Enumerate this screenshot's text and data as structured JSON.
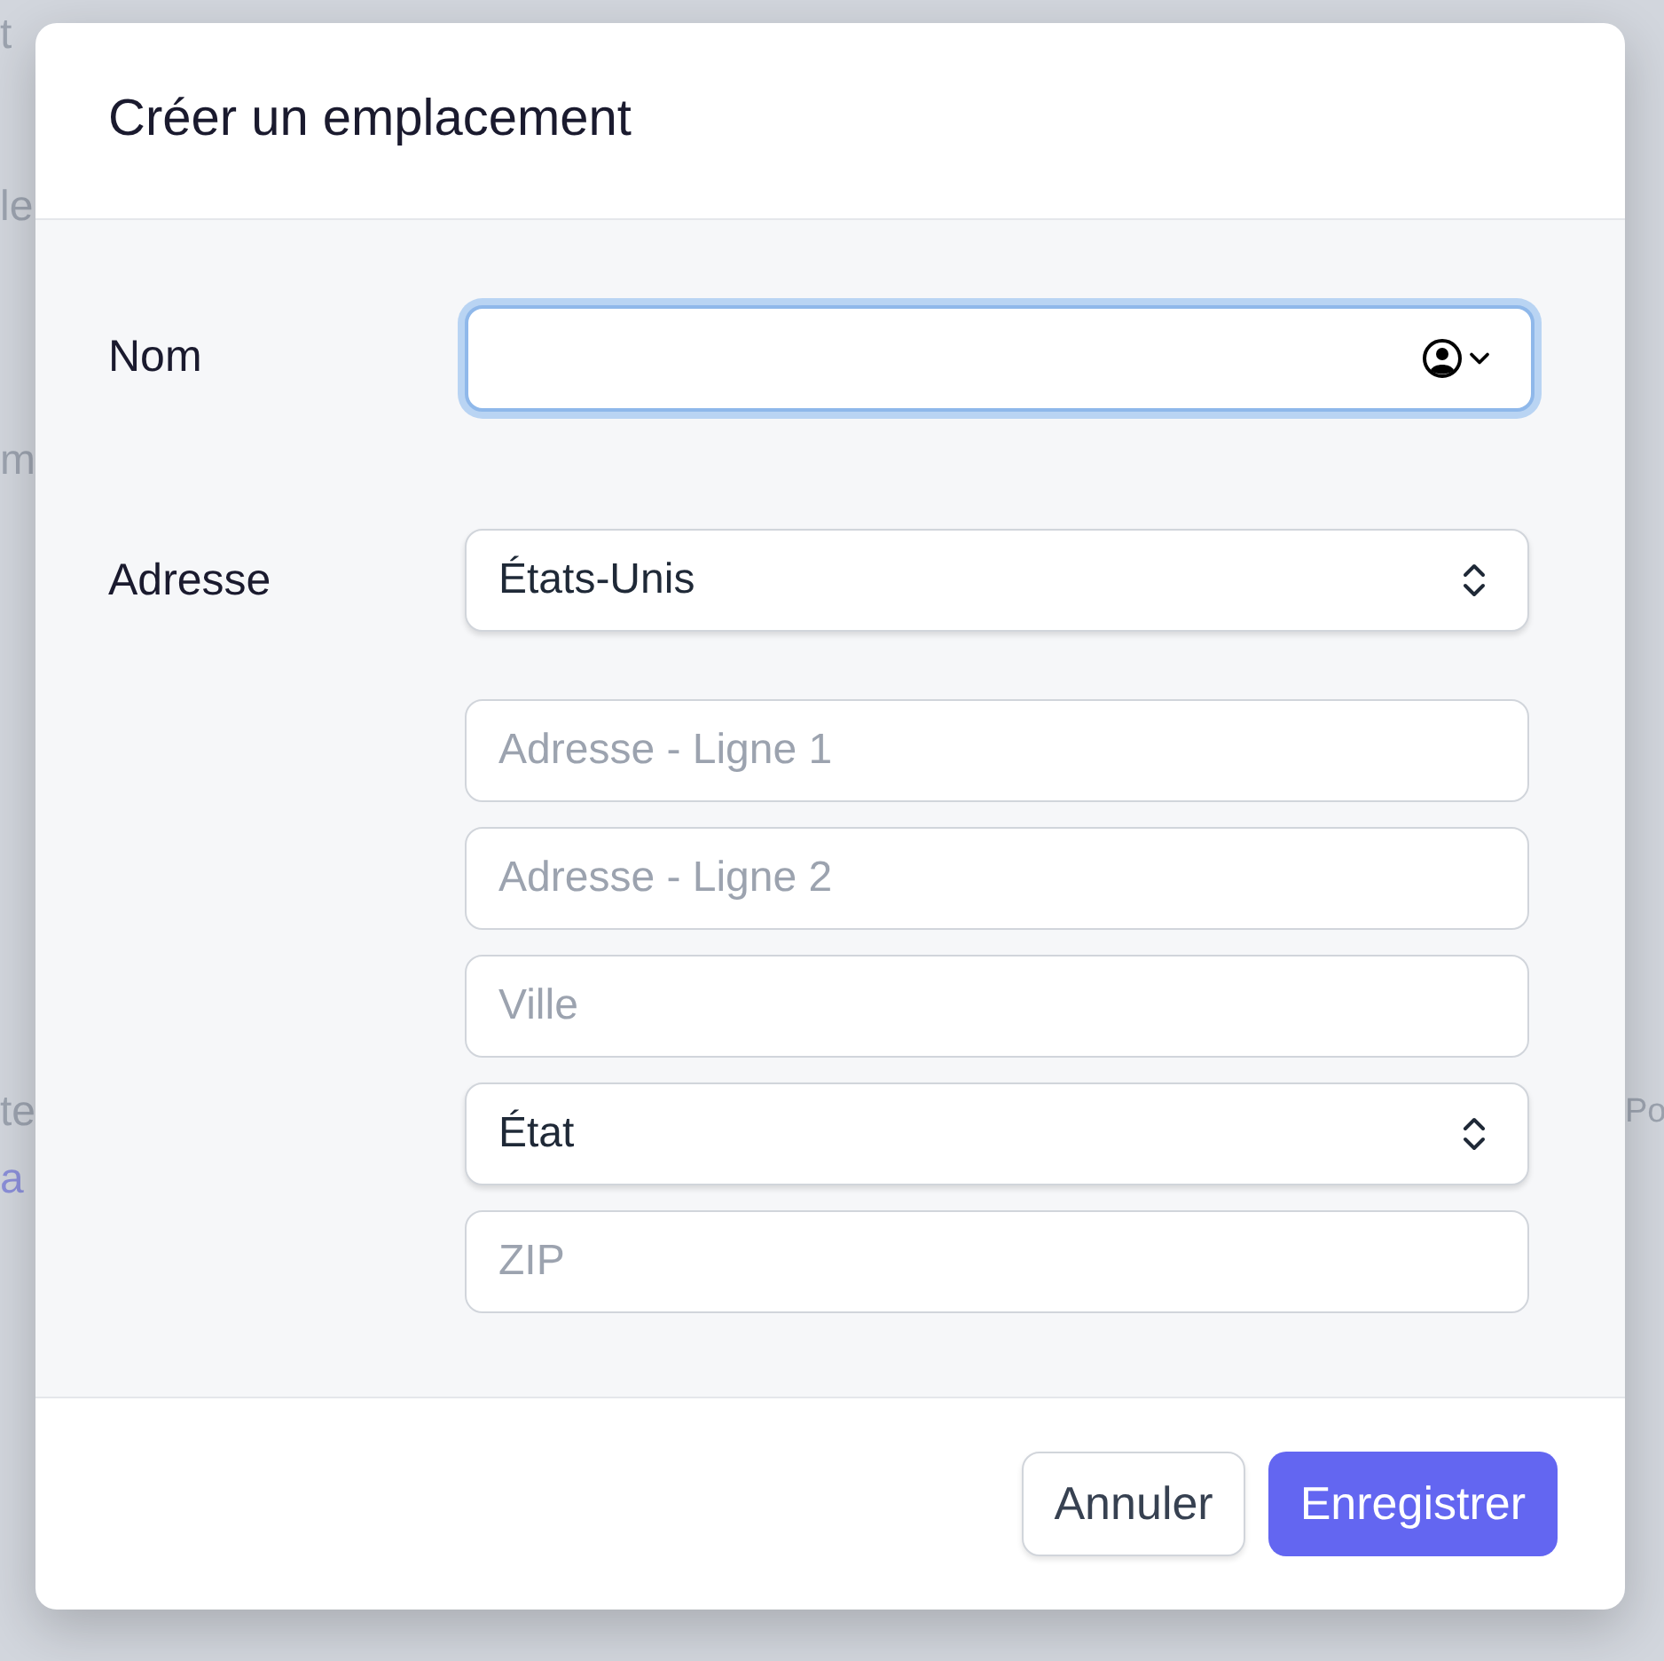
{
  "backdrop": {
    "left_fragments": [
      {
        "text": "t",
        "kind": "text"
      },
      {
        "text": "le",
        "kind": "text"
      },
      {
        "text": "m",
        "kind": "text"
      },
      {
        "text": "te",
        "kind": "text"
      },
      {
        "text": "a",
        "kind": "link"
      }
    ],
    "right_fragments": [
      {
        "text": "Po",
        "kind": "text"
      }
    ]
  },
  "dialog": {
    "title": "Créer un emplacement",
    "name": {
      "label": "Nom",
      "focused": true
    },
    "address": {
      "label": "Adresse",
      "fields": [
        {
          "kind": "select",
          "value": "États-Unis"
        },
        {
          "kind": "input",
          "placeholder": "Adresse - Ligne 1"
        },
        {
          "kind": "input",
          "placeholder": "Adresse - Ligne 2"
        },
        {
          "kind": "input",
          "placeholder": "Ville"
        },
        {
          "kind": "select",
          "value": "État"
        },
        {
          "kind": "input",
          "placeholder": "ZIP"
        }
      ]
    },
    "buttons": [
      {
        "label": "Annuler",
        "kind": "secondary"
      },
      {
        "label": "Enregistrer",
        "kind": "primary"
      }
    ]
  }
}
